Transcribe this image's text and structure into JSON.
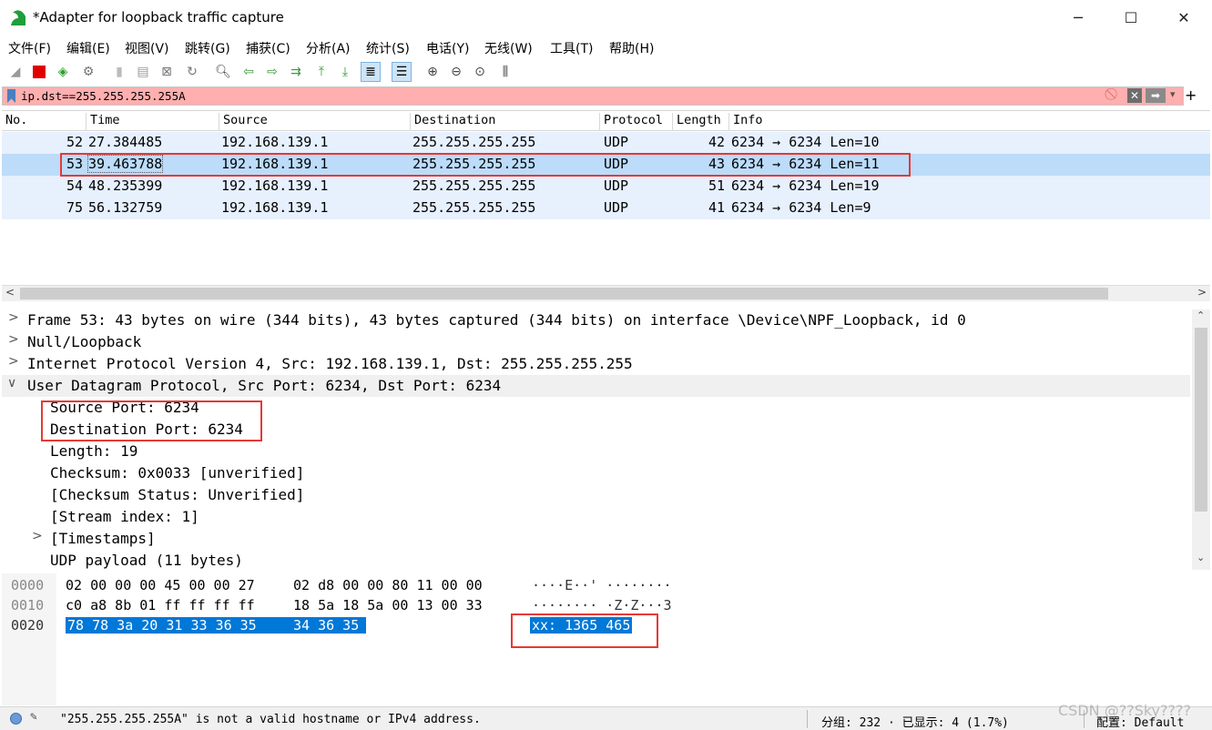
{
  "window": {
    "title": "*Adapter for loopback traffic capture",
    "min": "─",
    "max": "☐",
    "close": "✕"
  },
  "menu": [
    "文件(F)",
    "编辑(E)",
    "视图(V)",
    "跳转(G)",
    "捕获(C)",
    "分析(A)",
    "统计(S)",
    "电话(Y)",
    "无线(W)",
    "工具(T)",
    "帮助(H)"
  ],
  "filter": {
    "value": "ip.dst==255.255.255.255A",
    "plus": "+"
  },
  "columns": [
    "No.",
    "Time",
    "Source",
    "Destination",
    "Protocol",
    "Length",
    "Info"
  ],
  "packets": [
    {
      "no": "52",
      "time": "27.384485",
      "src": "192.168.139.1",
      "dst": "255.255.255.255",
      "proto": "UDP",
      "len": "42",
      "info": "6234 → 6234 Len=10"
    },
    {
      "no": "53",
      "time": "39.463788",
      "src": "192.168.139.1",
      "dst": "255.255.255.255",
      "proto": "UDP",
      "len": "43",
      "info": "6234 → 6234 Len=11"
    },
    {
      "no": "54",
      "time": "48.235399",
      "src": "192.168.139.1",
      "dst": "255.255.255.255",
      "proto": "UDP",
      "len": "51",
      "info": "6234 → 6234 Len=19"
    },
    {
      "no": "75",
      "time": "56.132759",
      "src": "192.168.139.1",
      "dst": "255.255.255.255",
      "proto": "UDP",
      "len": "41",
      "info": "6234 → 6234 Len=9"
    }
  ],
  "details": [
    {
      "arrow": ">",
      "text": "Frame 53: 43 bytes on wire (344 bits), 43 bytes captured (344 bits) on interface \\Device\\NPF_Loopback, id 0"
    },
    {
      "arrow": ">",
      "text": "Null/Loopback"
    },
    {
      "arrow": ">",
      "text": "Internet Protocol Version 4, Src: 192.168.139.1, Dst: 255.255.255.255"
    },
    {
      "arrow": "∨",
      "text": "User Datagram Protocol, Src Port: 6234, Dst Port: 6234"
    },
    {
      "arrow": "",
      "text": "Source Port: 6234"
    },
    {
      "arrow": "",
      "text": "Destination Port: 6234"
    },
    {
      "arrow": "",
      "text": "Length: 19"
    },
    {
      "arrow": "",
      "text": "Checksum: 0x0033 [unverified]"
    },
    {
      "arrow": "",
      "text": "[Checksum Status: Unverified]"
    },
    {
      "arrow": "",
      "text": "[Stream index: 1]"
    },
    {
      "arrow": ">",
      "text": "[Timestamps]"
    },
    {
      "arrow": "",
      "text": "UDP payload (11 bytes)"
    }
  ],
  "hex": [
    {
      "off": "0000",
      "a": "02 00 00 00 45 00 00 27",
      "b": "02 d8 00 00 80 11 00 00",
      "ascii": "····E··' ········"
    },
    {
      "off": "0010",
      "a": "c0 a8 8b 01 ff ff ff ff",
      "b": "18 5a 18 5a 00 13 00 33",
      "ascii": "········ ·Z·Z···3"
    },
    {
      "off": "0020",
      "a": "78 78 3a 20 31 33 36 35",
      "b": "34 36 35",
      "ascii": "xx: 1365 465"
    }
  ],
  "status": {
    "message": "\"255.255.255.255A\" is not a valid hostname or IPv4 address.",
    "groups": "分组: 232 · 已显示: 4 (1.7%)",
    "profile": "配置: Default",
    "watermark": "CSDN @??Sky????"
  },
  "colors": {
    "filter_bad": "#ffafaf",
    "row_bg": "#e7f0fd",
    "row_selected": "#bcdcf9",
    "hex_selected": "#0078d7",
    "annotation": "#e53935"
  }
}
